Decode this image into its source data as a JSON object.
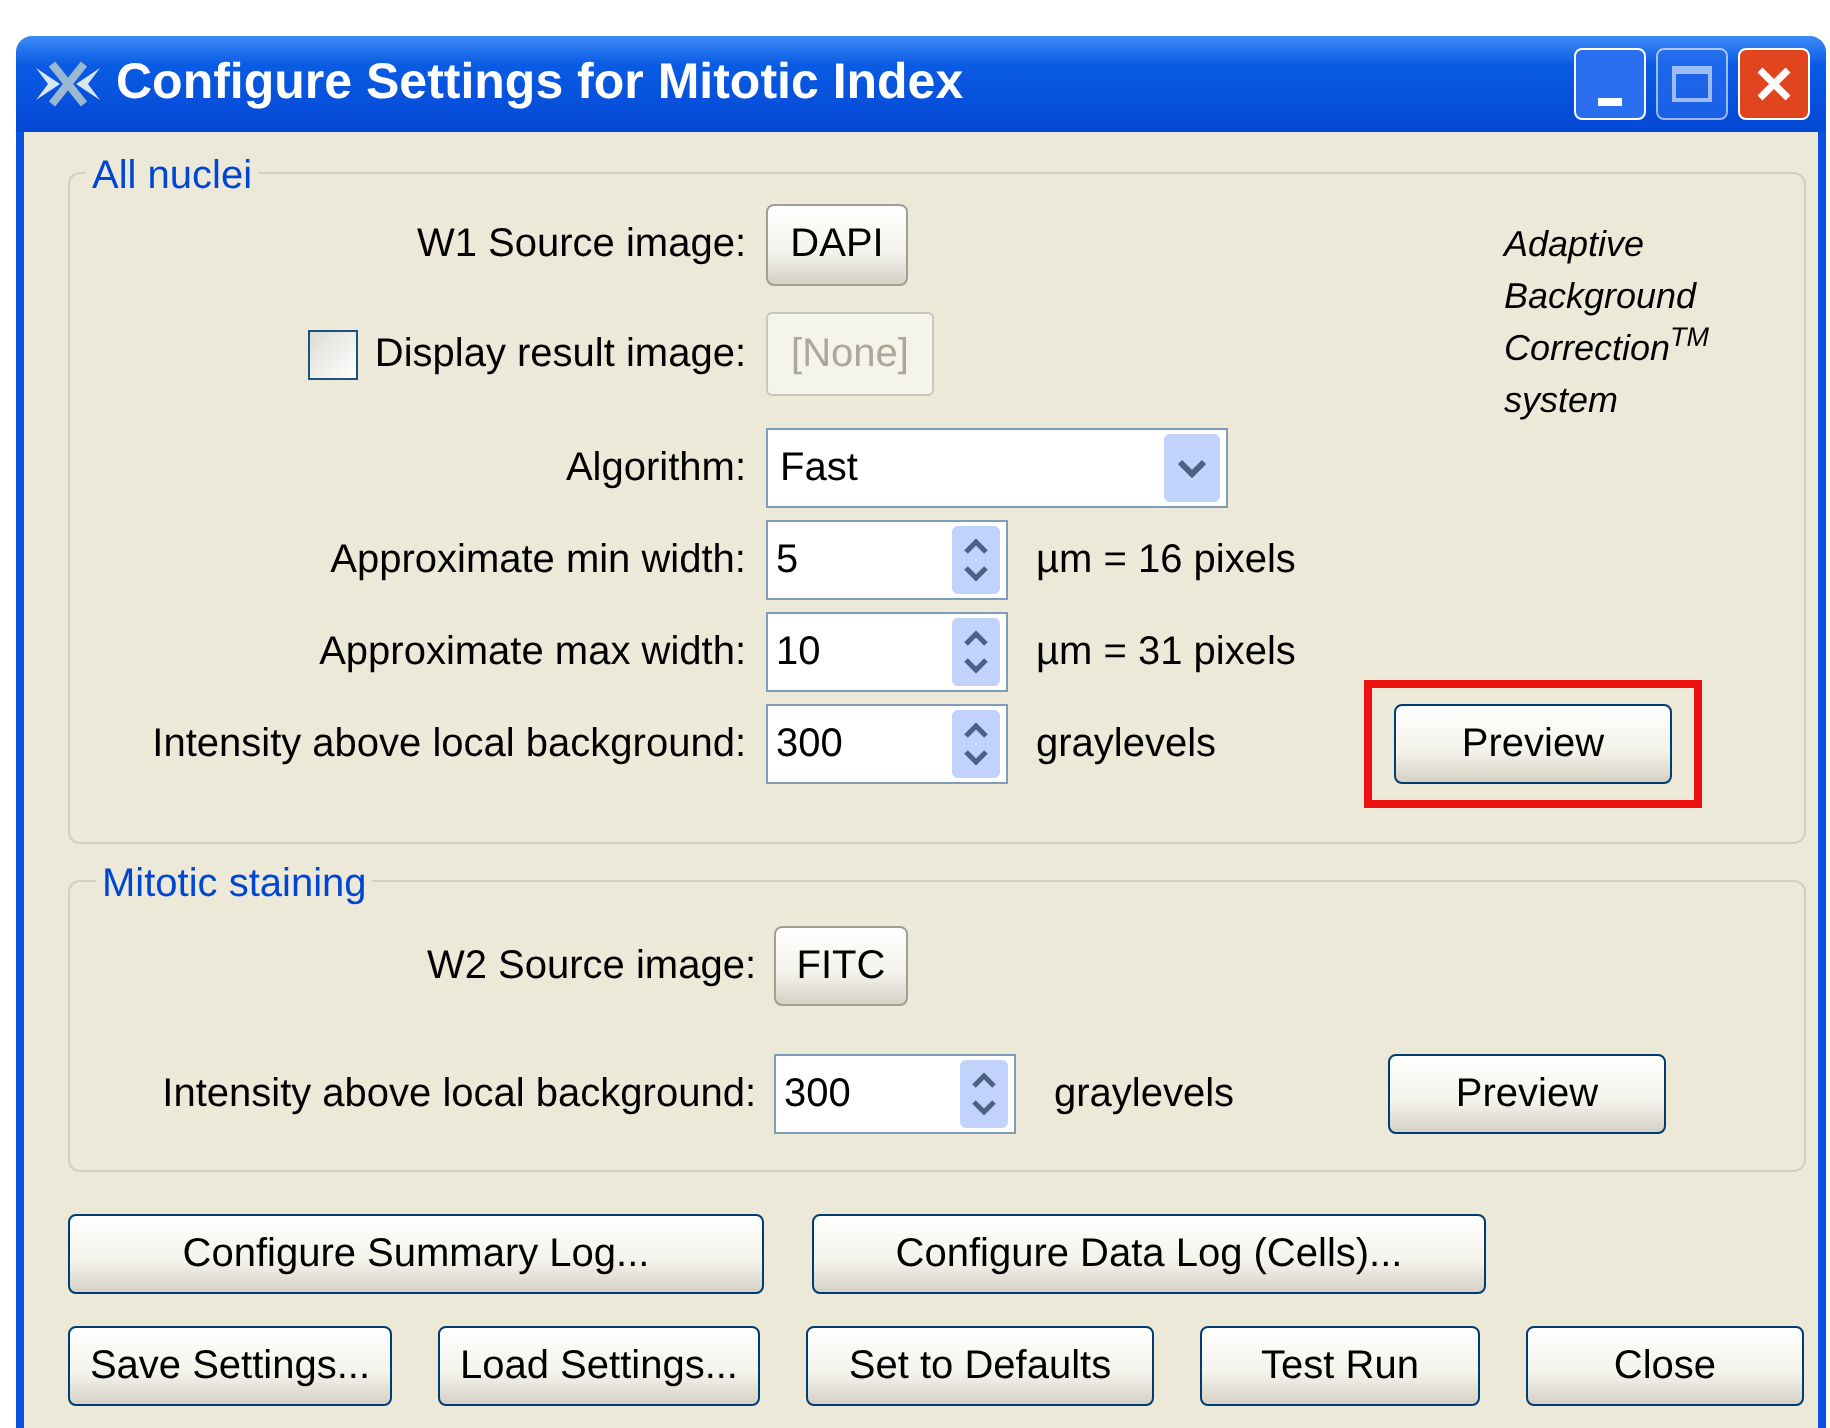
{
  "window": {
    "title": "Configure Settings for Mitotic Index"
  },
  "all_nuclei": {
    "legend": "All nuclei",
    "source": {
      "label": "W1 Source image:",
      "button": "DAPI"
    },
    "display_result": {
      "label": "Display result image:",
      "checked": false,
      "button": "[None]",
      "disabled": true
    },
    "note": [
      "Adaptive",
      "Background",
      "Correction$^{TM}$",
      "system"
    ],
    "algorithm": {
      "label": "Algorithm:",
      "value": "Fast"
    },
    "fields": [
      {
        "label": "Approximate min width:",
        "value": "5",
        "unit": "µm = 16 pixels"
      },
      {
        "label": "Approximate max width:",
        "value": "10",
        "unit": "µm = 31 pixels"
      },
      {
        "label": "Intensity above local background:",
        "value": "300",
        "unit": "graylevels"
      }
    ],
    "preview": {
      "label": "Preview",
      "highlighted": true
    }
  },
  "mitotic_staining": {
    "legend": "Mitotic staining",
    "source": {
      "label": "W2 Source image:",
      "button": "FITC"
    },
    "fields": [
      {
        "label": "Intensity above local background:",
        "value": "300",
        "unit": "graylevels"
      }
    ],
    "preview": {
      "label": "Preview",
      "highlighted": false
    }
  },
  "log_buttons": [
    "Configure Summary Log...",
    "Configure Data Log (Cells)..."
  ],
  "action_buttons": [
    "Save Settings...",
    "Load Settings...",
    "Set to Defaults",
    "Test Run",
    "Close"
  ]
}
